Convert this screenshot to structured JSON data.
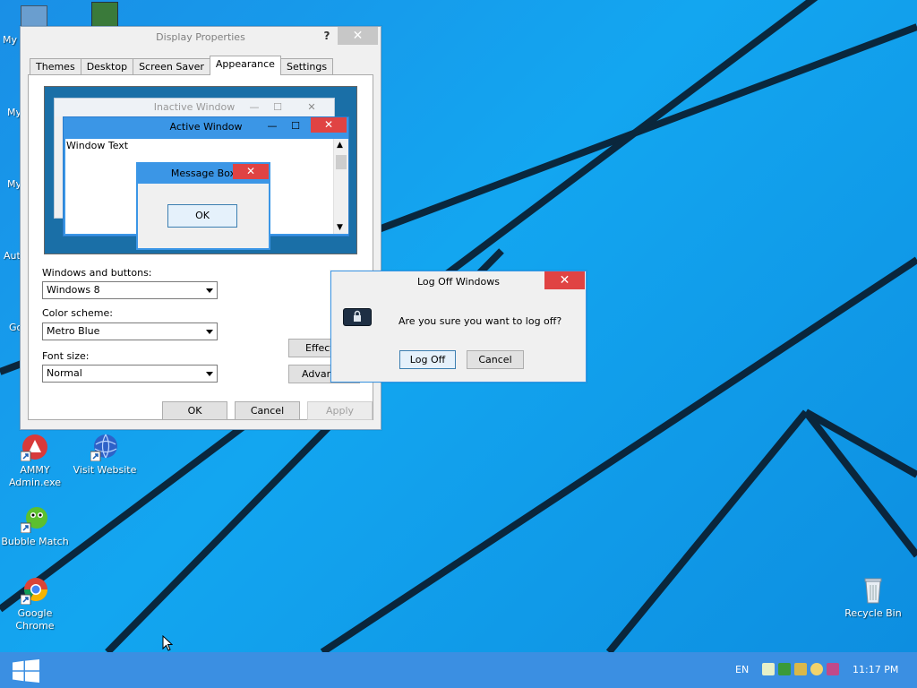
{
  "desktop": {
    "partial_labels": [
      "My",
      "My",
      "My",
      "Auto",
      "Go"
    ],
    "icons": [
      {
        "label": "AMMY Admin.exe",
        "line1": "AMMY",
        "line2": "Admin.exe"
      },
      {
        "label": "Visit Website"
      },
      {
        "label": "Bubble Match"
      },
      {
        "label": "Google Chrome"
      },
      {
        "label": "Recycle Bin"
      }
    ]
  },
  "display_properties": {
    "title": "Display Properties",
    "help": "?",
    "close": "✕",
    "tabs": [
      "Themes",
      "Desktop",
      "Screen Saver",
      "Appearance",
      "Settings"
    ],
    "active_tab": "Appearance",
    "preview": {
      "inactive_title": "Inactive Window",
      "active_title": "Active Window",
      "window_text": "Window Text",
      "message_title": "Message Box",
      "ok": "OK"
    },
    "windows_buttons_label": "Windows and buttons:",
    "windows_buttons_value": "Windows 8",
    "color_scheme_label": "Color scheme:",
    "color_scheme_value": "Metro Blue",
    "font_size_label": "Font size:",
    "font_size_value": "Normal",
    "effects_label": "Effects...",
    "advanced_label": "Advanced",
    "ok": "OK",
    "cancel": "Cancel",
    "apply": "Apply"
  },
  "logoff_dialog": {
    "title": "Log Off Windows",
    "close": "✕",
    "message": "Are you sure you want to log off?",
    "log_off": "Log Off",
    "cancel": "Cancel"
  },
  "taskbar": {
    "language": "EN",
    "clock": "11:17 PM"
  },
  "colors": {
    "accent_blue": "#3b96e6",
    "close_red": "#e04343",
    "taskbar": "#3b8fe2"
  }
}
